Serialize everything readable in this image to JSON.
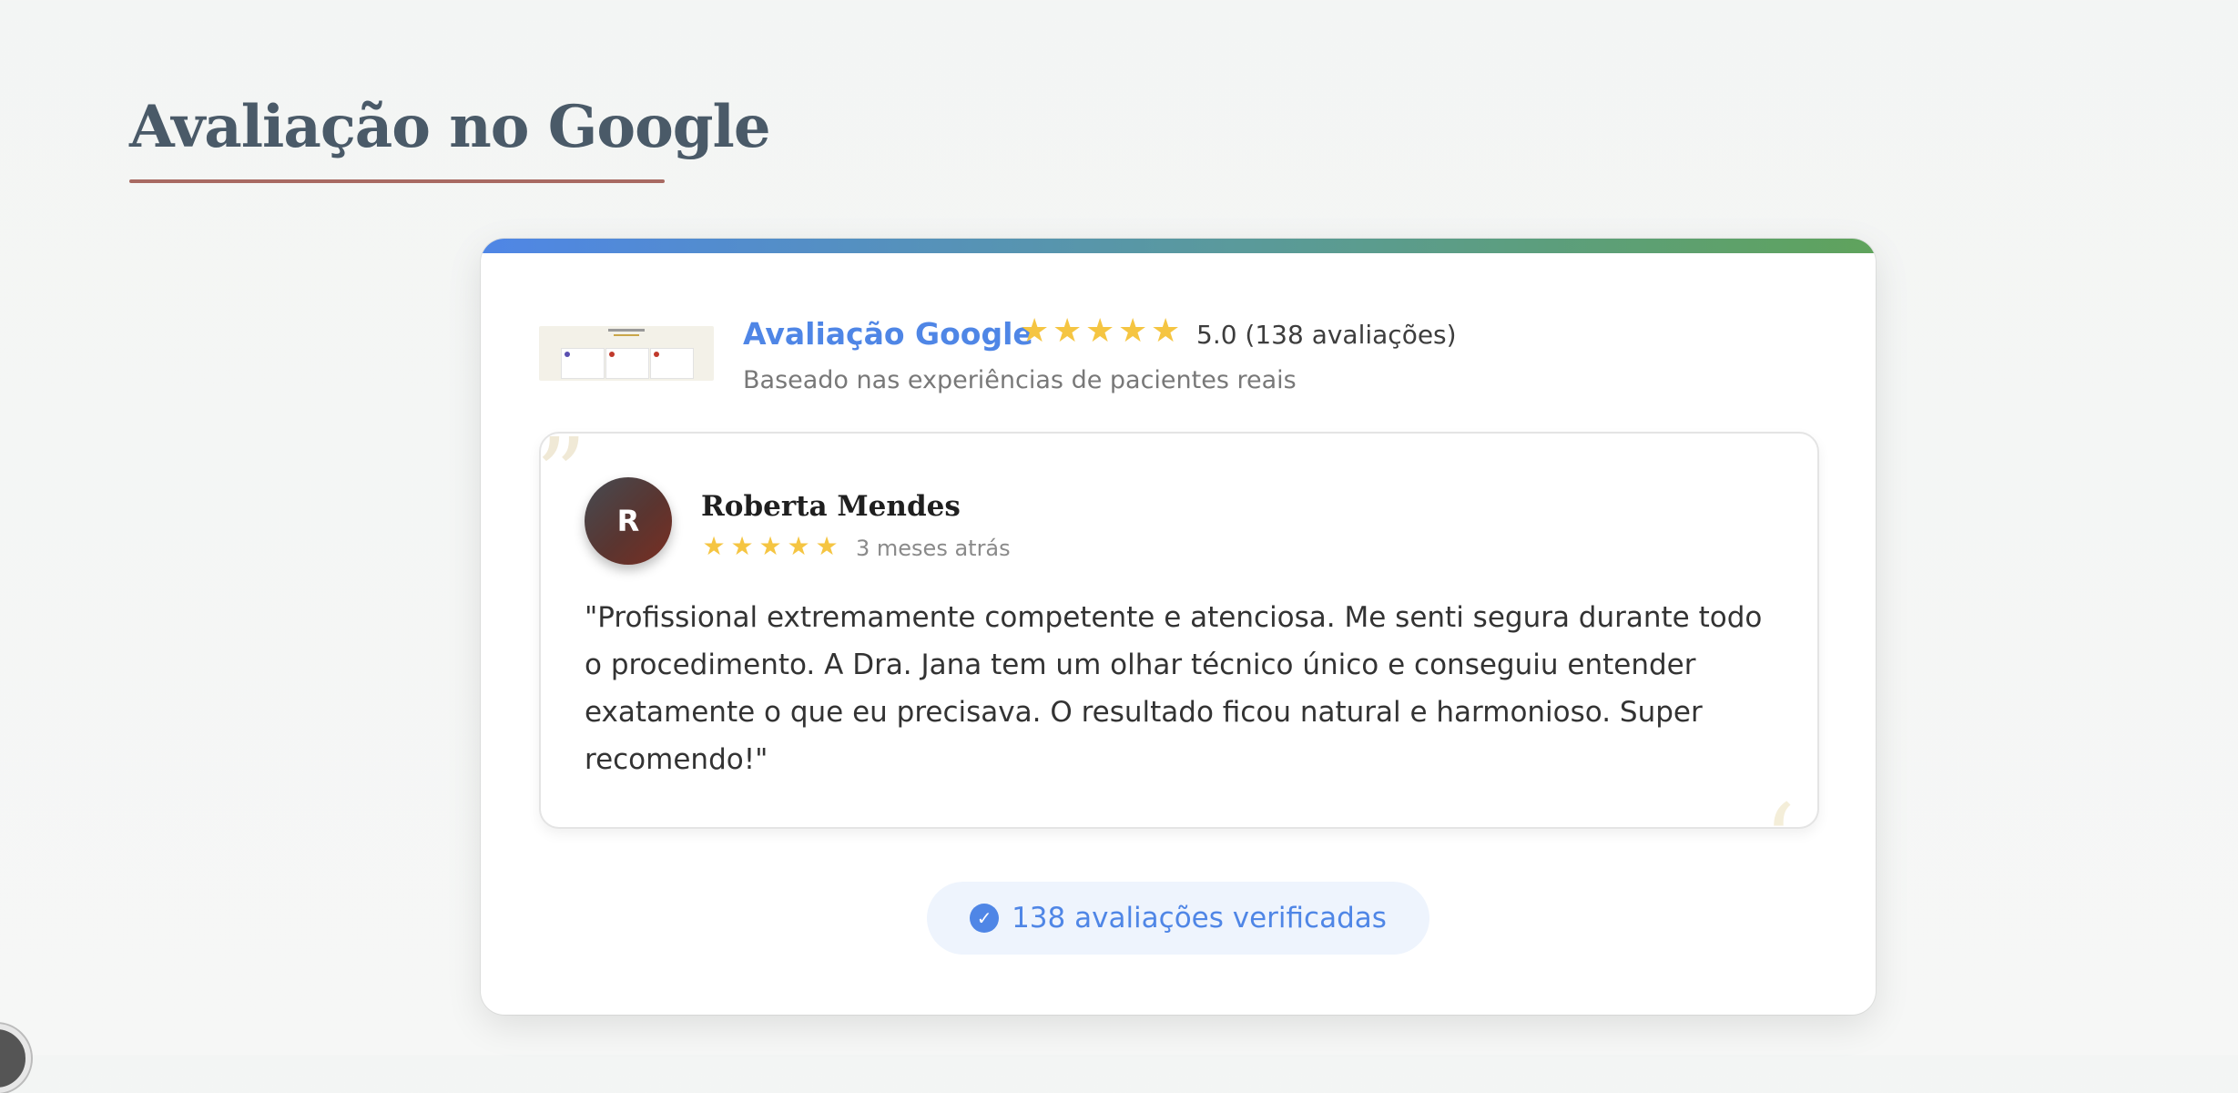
{
  "page": {
    "section_title": "Avaliação no Google"
  },
  "card": {
    "header": {
      "title": "Avaliação Google",
      "rating": "5.0 (138 avaliações)",
      "stars": 5,
      "subtitle": "Baseado nas experiências de pacientes reais",
      "thumbnail_icon": "review-screenshot-thumbnail"
    },
    "review": {
      "avatar_initial": "R",
      "name": "Roberta Mendes",
      "stars": 5,
      "time": "3 meses atrás",
      "text": "\"Profissional extremamente competente e atenciosa. Me senti segura durante todo o procedimento. A Dra. Jana tem um olhar técnico único e conseguiu entender exatamente o que eu precisava. O resultado ficou natural e harmonioso. Super recomendo!\""
    },
    "verified": {
      "icon": "check-circle-icon",
      "label": "138 avaliações verificadas"
    }
  },
  "colors": {
    "accent_blue": "#4f86e6",
    "accent_green": "#5fa35c",
    "star": "#f5c542",
    "title": "#4a5a68",
    "underline": "#a86a62"
  }
}
